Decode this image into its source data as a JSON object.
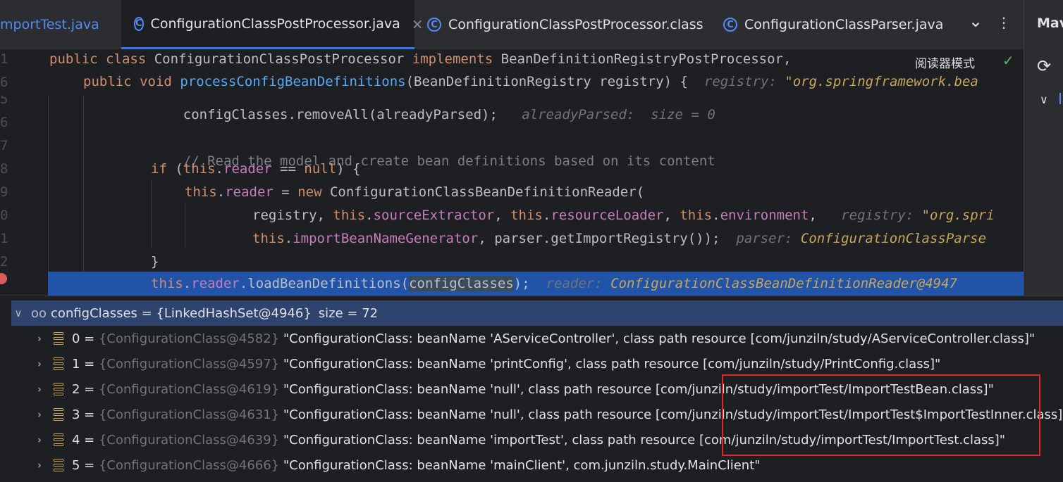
{
  "tabs": [
    {
      "label": "mportTest.java",
      "active": false
    },
    {
      "label": "ConfigurationClassPostProcessor.java",
      "active": true
    },
    {
      "label": "ConfigurationClassPostProcessor.class",
      "active": false
    },
    {
      "label": "ConfigurationClassParser.java",
      "active": false
    }
  ],
  "tab_icon_letter": "C",
  "tab_close": "×",
  "tab_menu_icon": "⌄",
  "tab_more_icon": "⋮",
  "right_panel": {
    "title": "Mav"
  },
  "reader_mode": "阅读器模式",
  "editor": {
    "line_numbers": [
      "1",
      "6",
      "5",
      "6",
      "7",
      "8",
      "9",
      "0",
      "1",
      "2",
      ""
    ],
    "sticky1": {
      "kw1": "public",
      "kw2": "class",
      "name": " ConfigurationClassPostProcessor ",
      "kw3": "implements",
      "rest": " BeanDefinitionRegistryPostProcessor,"
    },
    "sticky2": {
      "kw1": "public",
      "kw2": "void",
      "fn": "processConfigBeanDefinitions",
      "rest": "(BeanDefinitionRegistry registry) {",
      "hint": "registry:",
      "hintv": "\"org.springframework.bea"
    },
    "line1": {
      "code": "configClasses.removeAll(alreadyParsed);",
      "hint": "alreadyParsed:  size = 0"
    },
    "line3": {
      "comment": "// Read the model and create bean definitions based on its content"
    },
    "line4": {
      "kw": "if",
      "p1": " (",
      "this": "this",
      "dot": ".",
      "fld": "reader",
      "p2": " == ",
      "null": "null",
      "p3": ") {"
    },
    "line5": {
      "this": "this",
      "fld": "reader",
      "p1": " = ",
      "new": "new",
      "rest": " ConfigurationClassBeanDefinitionReader("
    },
    "line6": {
      "a": "registry, ",
      "this1": "this",
      "f1": "sourceExtractor",
      "b": ", ",
      "this2": "this",
      "f2": "resourceLoader",
      "c": ", ",
      "this3": "this",
      "f3": "environment",
      "d": ",",
      "hint": "registry:",
      "hintv": "\"org.spri"
    },
    "line7": {
      "this": "this",
      "fld": "importBeanNameGenerator",
      "rest": ", parser.getImportRegistry());",
      "hint": "parser:",
      "hintv": "ConfigurationClassParse"
    },
    "line8": {
      "code": "}"
    },
    "line9": {
      "this": "this",
      "fld": "reader",
      "mid": ".loadBeanDefinitions(",
      "arg": "configClasses",
      "end": ");",
      "hint": "reader:",
      "hintv": "ConfigurationClassBeanDefinitionReader@4947"
    }
  },
  "debug": {
    "root": {
      "name": "configClasses",
      "eq": " = ",
      "value": "{LinkedHashSet@4946}",
      "size": "size = 72"
    },
    "items": [
      {
        "index": "0",
        "ref": "{ConfigurationClass@4582}",
        "value": "\"ConfigurationClass: beanName 'AServiceController', class path resource [com/junziln/study/AServiceController.class]\""
      },
      {
        "index": "1",
        "ref": "{ConfigurationClass@4597}",
        "value": "\"ConfigurationClass: beanName 'printConfig', class path resource [com/junziln/study/PrintConfig.class]\""
      },
      {
        "index": "2",
        "ref": "{ConfigurationClass@4619}",
        "value": "\"ConfigurationClass: beanName 'null', class path resource [com/junziln/study/importTest/ImportTestBean.class]\""
      },
      {
        "index": "3",
        "ref": "{ConfigurationClass@4631}",
        "value": "\"ConfigurationClass: beanName 'null', class path resource [com/junziln/study/importTest/ImportTest$ImportTestInner.class]\""
      },
      {
        "index": "4",
        "ref": "{ConfigurationClass@4639}",
        "value": "\"ConfigurationClass: beanName 'importTest', class path resource [com/junziln/study/importTest/ImportTest.class]\""
      },
      {
        "index": "5",
        "ref": "{ConfigurationClass@4666}",
        "value": "\"ConfigurationClass: beanName 'mainClient', com.junziln.study.MainClient\""
      }
    ]
  },
  "colors": {
    "accent": "#3574f0",
    "highlight_line": "#2154a8",
    "annotation_box": "#e0262b"
  }
}
